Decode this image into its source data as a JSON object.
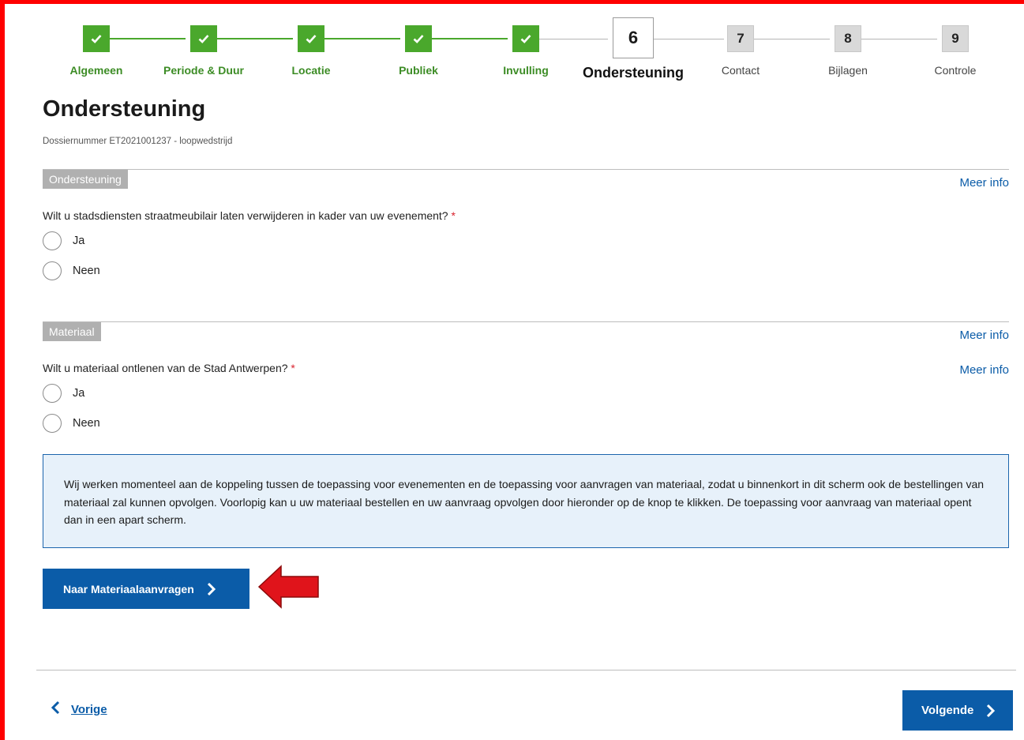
{
  "stepper": {
    "steps": [
      {
        "label": "Algemeen",
        "number": "",
        "state": "done"
      },
      {
        "label": "Periode & Duur",
        "number": "",
        "state": "done"
      },
      {
        "label": "Locatie",
        "number": "",
        "state": "done"
      },
      {
        "label": "Publiek",
        "number": "",
        "state": "done"
      },
      {
        "label": "Invulling",
        "number": "",
        "state": "done"
      },
      {
        "label": "Ondersteuning",
        "number": "6",
        "state": "current"
      },
      {
        "label": "Contact",
        "number": "7",
        "state": "todo"
      },
      {
        "label": "Bijlagen",
        "number": "8",
        "state": "todo"
      },
      {
        "label": "Controle",
        "number": "9",
        "state": "todo"
      }
    ]
  },
  "page": {
    "title": "Ondersteuning",
    "dossier": "Dossiernummer ET2021001237 - loopwedstrijd"
  },
  "section_ondersteuning": {
    "tag": "Ondersteuning",
    "meer_info": "Meer info",
    "question": "Wilt u stadsdiensten straatmeubilair laten verwijderen in kader van uw evenement?",
    "required_mark": "*",
    "options": [
      "Ja",
      "Neen"
    ]
  },
  "section_materiaal": {
    "tag": "Materiaal",
    "meer_info": "Meer info",
    "question": "Wilt u materiaal ontlenen van de Stad Antwerpen?",
    "required_mark": "*",
    "question_meer_info": "Meer info",
    "options": [
      "Ja",
      "Neen"
    ]
  },
  "info_box": {
    "text": "Wij werken momenteel aan de koppeling tussen de toepassing voor evenementen en de toepassing voor aanvragen van materiaal, zodat u binnenkort in dit scherm ook de bestellingen van materiaal zal kunnen opvolgen. Voorlopig kan u uw materiaal bestellen en uw aanvraag opvolgen door hieronder op de knop te klikken. De toepassing voor aanvraag van materiaal opent dan in een apart scherm."
  },
  "buttons": {
    "materiaal": "Naar Materiaalaanvragen",
    "previous": "Vorige",
    "next": "Volgende"
  },
  "colors": {
    "done_green": "#4aa82c",
    "primary_blue": "#0b5ca8",
    "annotation_red": "#ff0000"
  }
}
